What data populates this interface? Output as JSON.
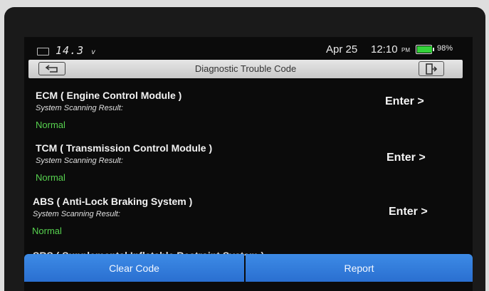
{
  "status_bar": {
    "voltage": "14.3",
    "voltage_unit": "v",
    "date": "Apr 25",
    "time": "12:10",
    "ampm": "PM",
    "battery_percent": "98%",
    "battery_level": 0.98,
    "battery_color": "#34d23a"
  },
  "header": {
    "title": "Diagnostic Trouble Code"
  },
  "modules": [
    {
      "name": "ECM ( Engine Control Module )",
      "result_label": "System Scanning Result:",
      "result": "Normal",
      "action": "Enter >"
    },
    {
      "name": "TCM ( Transmission Control Module )",
      "result_label": "System Scanning Result:",
      "result": "Normal",
      "action": "Enter >"
    },
    {
      "name": "ABS ( Anti-Lock Braking System )",
      "result_label": "System Scanning Result:",
      "result": "Normal",
      "action": "Enter >"
    },
    {
      "name": "SRS ( Supplemental Inflatable Restraint System )"
    }
  ],
  "footer": {
    "clear_label": "Clear Code",
    "report_label": "Report",
    "button_color": "#2f7cdd"
  },
  "colors": {
    "normal_status": "#57d24f"
  }
}
